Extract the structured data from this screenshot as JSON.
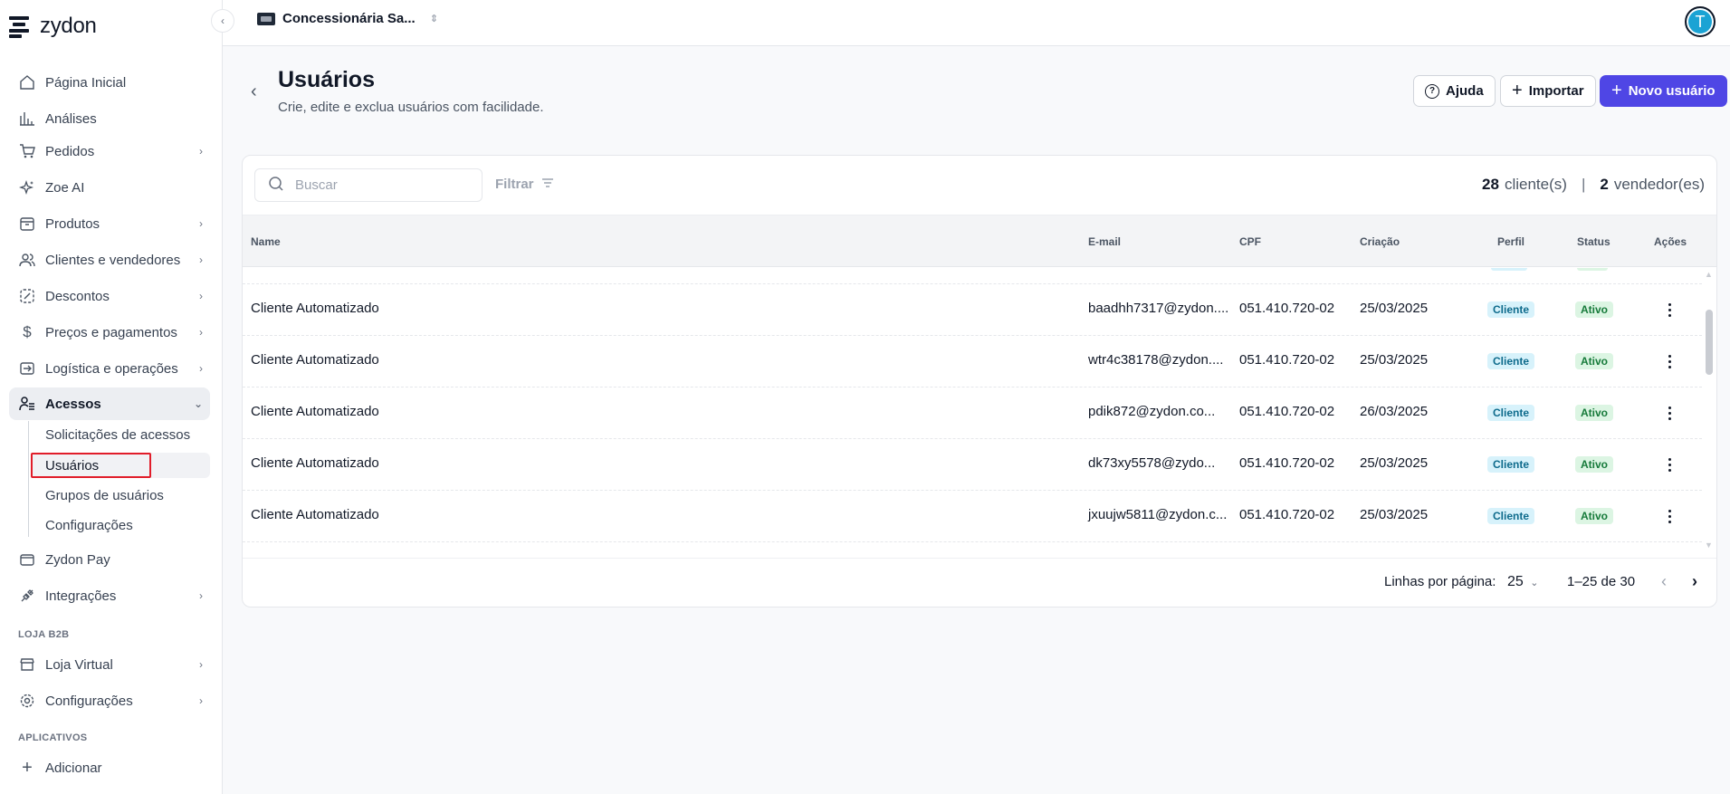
{
  "app": {
    "name": "zydon"
  },
  "topbar": {
    "store_name": "Concessionária Sa...",
    "avatar_initial": "T"
  },
  "sidebar": {
    "items": [
      {
        "label": "Página Inicial"
      },
      {
        "label": "Análises"
      },
      {
        "label": "Pedidos"
      },
      {
        "label": "Zoe AI"
      },
      {
        "label": "Produtos"
      },
      {
        "label": "Clientes e vendedores"
      },
      {
        "label": "Descontos"
      },
      {
        "label": "Preços e pagamentos"
      },
      {
        "label": "Logística e operações"
      },
      {
        "label": "Acessos"
      },
      {
        "label": "Zydon Pay"
      },
      {
        "label": "Integrações"
      }
    ],
    "acessos_sub": [
      {
        "label": "Solicitações de acessos"
      },
      {
        "label": "Usuários"
      },
      {
        "label": "Grupos de usuários"
      },
      {
        "label": "Configurações"
      }
    ],
    "section_loja": "LOJA B2B",
    "loja_items": [
      {
        "label": "Loja Virtual"
      },
      {
        "label": "Configurações"
      }
    ],
    "section_apps": "APLICATIVOS",
    "add_label": "Adicionar"
  },
  "page": {
    "title": "Usuários",
    "subtitle": "Crie, edite e exclua usuários com facilidade.",
    "help_label": "Ajuda",
    "import_label": "Importar",
    "new_user_label": "Novo usuário"
  },
  "toolbar": {
    "search_placeholder": "Buscar",
    "filter_label": "Filtrar",
    "clients_count": "28",
    "clients_label": "cliente(s)",
    "sep": "|",
    "sellers_count": "2",
    "sellers_label": "vendedor(es)"
  },
  "table": {
    "headers": {
      "name": "Name",
      "email": "E-mail",
      "cpf": "CPF",
      "created": "Criação",
      "profile": "Perfil",
      "status": "Status",
      "actions": "Ações"
    },
    "rows": [
      {
        "name": "Cliente Automatizado",
        "email": "baadhh7317@zydon....",
        "cpf": "051.410.720-02",
        "created": "25/03/2025",
        "profile": "Cliente",
        "status": "Ativo"
      },
      {
        "name": "Cliente Automatizado",
        "email": "wtr4c38178@zydon....",
        "cpf": "051.410.720-02",
        "created": "25/03/2025",
        "profile": "Cliente",
        "status": "Ativo"
      },
      {
        "name": "Cliente Automatizado",
        "email": "pdik872@zydon.co...",
        "cpf": "051.410.720-02",
        "created": "26/03/2025",
        "profile": "Cliente",
        "status": "Ativo"
      },
      {
        "name": "Cliente Automatizado",
        "email": "dk73xy5578@zydo...",
        "cpf": "051.410.720-02",
        "created": "25/03/2025",
        "profile": "Cliente",
        "status": "Ativo"
      },
      {
        "name": "Cliente Automatizado",
        "email": "jxuujw5811@zydon.c...",
        "cpf": "051.410.720-02",
        "created": "25/03/2025",
        "profile": "Cliente",
        "status": "Ativo"
      }
    ]
  },
  "pagination": {
    "rows_per_page_label": "Linhas por página:",
    "rows_per_page_value": "25",
    "range": "1–25 de 30"
  },
  "colors": {
    "primary": "#4f46e5",
    "highlight": "#e11d2a",
    "avatar": "#1aa3d4"
  }
}
